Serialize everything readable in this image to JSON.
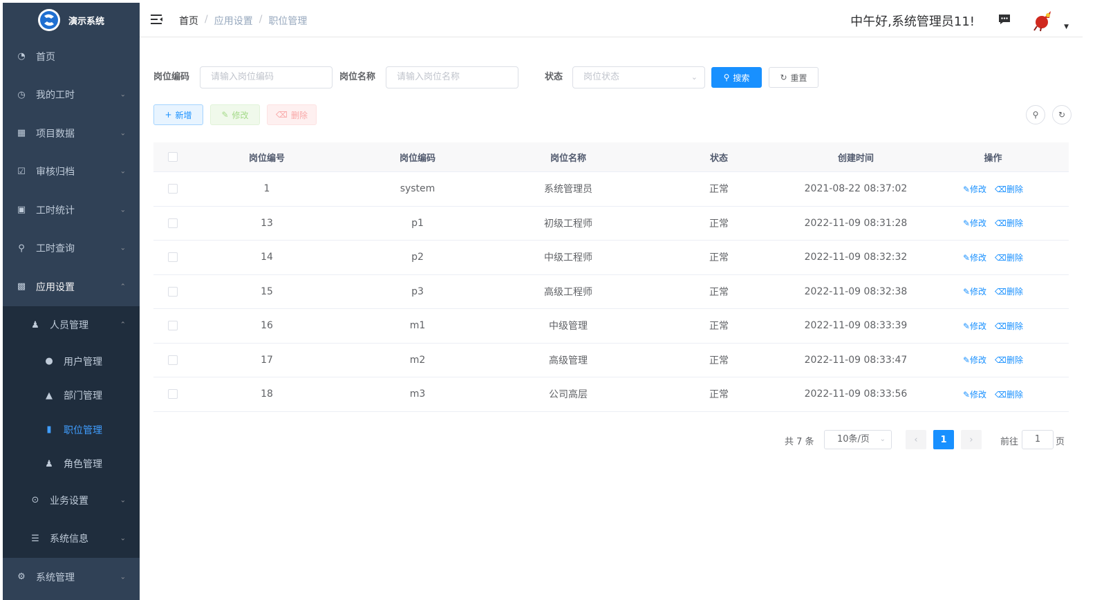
{
  "app": {
    "title": "演示系统"
  },
  "sidebar": {
    "items": [
      {
        "label": "首页",
        "icon": "dashboard-icon"
      },
      {
        "label": "我的工时",
        "icon": "clock-icon"
      },
      {
        "label": "项目数据",
        "icon": "table-icon"
      },
      {
        "label": "审核归档",
        "icon": "checkbox-icon"
      },
      {
        "label": "工时统计",
        "icon": "chart-icon"
      },
      {
        "label": "工时查询",
        "icon": "search-icon"
      },
      {
        "label": "应用设置",
        "icon": "app-icon"
      }
    ],
    "personnel": {
      "label": "人员管理",
      "icon": "peoples-icon"
    },
    "personnel_children": [
      {
        "label": "用户管理",
        "icon": "user-icon"
      },
      {
        "label": "部门管理",
        "icon": "tree-icon"
      },
      {
        "label": "职位管理",
        "icon": "post-icon"
      },
      {
        "label": "角色管理",
        "icon": "peoples-icon"
      }
    ],
    "business": {
      "label": "业务设置",
      "icon": "circle-check-icon"
    },
    "sysinfo": {
      "label": "系统信息",
      "icon": "list-icon"
    },
    "system": {
      "label": "系统管理",
      "icon": "gear-icon"
    }
  },
  "header": {
    "breadcrumb": [
      "首页",
      "应用设置",
      "职位管理"
    ],
    "greeting": "中午好,系统管理员11!",
    "separator": "/"
  },
  "search": {
    "code_label": "岗位编码",
    "code_placeholder": "请输入岗位编码",
    "name_label": "岗位名称",
    "name_placeholder": "请输入岗位名称",
    "status_label": "状态",
    "status_placeholder": "岗位状态",
    "search_btn": "搜索",
    "reset_btn": "重置"
  },
  "toolbar": {
    "add": "新增",
    "edit": "修改",
    "delete": "删除"
  },
  "table": {
    "headers": [
      "岗位编号",
      "岗位编码",
      "岗位名称",
      "状态",
      "创建时间",
      "操作"
    ],
    "edit_label": "修改",
    "delete_label": "删除",
    "rows": [
      {
        "id": "1",
        "code": "system",
        "name": "系统管理员",
        "status": "正常",
        "created": "2021-08-22 08:37:02"
      },
      {
        "id": "13",
        "code": "p1",
        "name": "初级工程师",
        "status": "正常",
        "created": "2022-11-09 08:31:28"
      },
      {
        "id": "14",
        "code": "p2",
        "name": "中级工程师",
        "status": "正常",
        "created": "2022-11-09 08:32:32"
      },
      {
        "id": "15",
        "code": "p3",
        "name": "高级工程师",
        "status": "正常",
        "created": "2022-11-09 08:32:38"
      },
      {
        "id": "16",
        "code": "m1",
        "name": "中级管理",
        "status": "正常",
        "created": "2022-11-09 08:33:39"
      },
      {
        "id": "17",
        "code": "m2",
        "name": "高级管理",
        "status": "正常",
        "created": "2022-11-09 08:33:47"
      },
      {
        "id": "18",
        "code": "m3",
        "name": "公司高层",
        "status": "正常",
        "created": "2022-11-09 08:33:56"
      }
    ]
  },
  "pagination": {
    "total": "共 7 条",
    "page_size": "10条/页",
    "current_page": "1",
    "goto_label": "前往",
    "goto_value": "1",
    "goto_unit": "页"
  },
  "colors": {
    "sidebar_bg": "#304156",
    "submenu_bg": "#1f2d3d",
    "primary": "#1890ff",
    "active_menu": "#409eff"
  }
}
